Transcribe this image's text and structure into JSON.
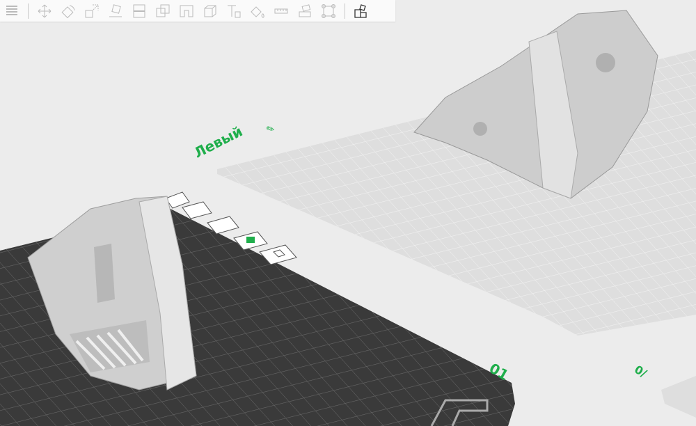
{
  "toolbar": {
    "tools": [
      {
        "name": "menu-icon"
      },
      {
        "name": "move-icon"
      },
      {
        "name": "rotate-icon"
      },
      {
        "name": "scale-icon"
      },
      {
        "name": "lay-on-face-icon"
      },
      {
        "name": "cut-icon"
      },
      {
        "name": "boolean-icon"
      },
      {
        "name": "support-paint-icon"
      },
      {
        "name": "seam-paint-icon"
      },
      {
        "name": "text-emboss-icon"
      },
      {
        "name": "color-paint-icon"
      },
      {
        "name": "measure-icon"
      },
      {
        "name": "assembly-icon"
      },
      {
        "name": "mesh-boolean-icon"
      },
      {
        "name": "arrange-icon"
      }
    ]
  },
  "plates": {
    "plate1": {
      "label": "Левый",
      "name_edit_icon": "edit-icon"
    },
    "plate2": {
      "label": "01"
    },
    "plate3": {
      "label": "0/"
    }
  },
  "colors": {
    "accent": "#1fae4b",
    "plate_dark": "#3a3a3a",
    "plate_light": "#dcdcdc",
    "model": "#cfcfcf"
  }
}
